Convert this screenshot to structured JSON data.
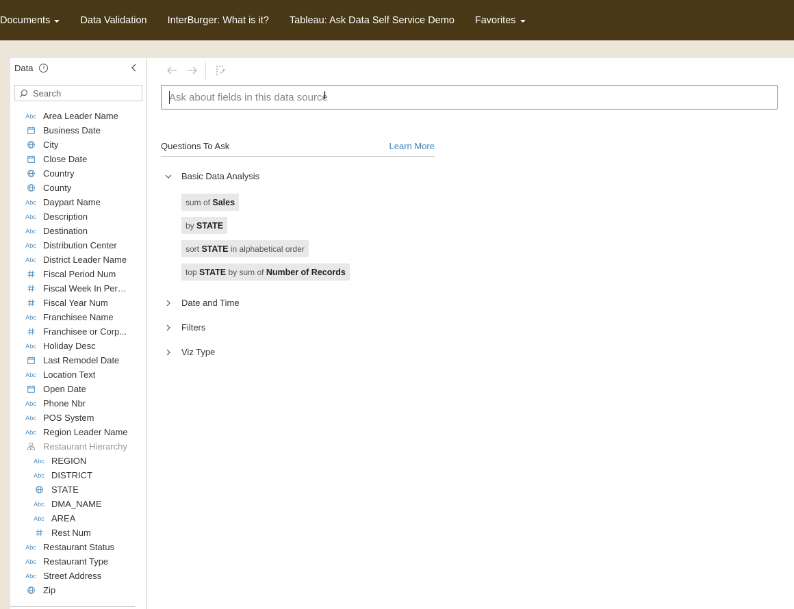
{
  "nav": {
    "items": [
      {
        "label": "Documents",
        "dropdown": true
      },
      {
        "label": "Data Validation",
        "dropdown": false
      },
      {
        "label": "InterBurger: What is it?",
        "dropdown": false
      },
      {
        "label": "Tableau: Ask Data Self Service Demo",
        "dropdown": false
      },
      {
        "label": "Favorites",
        "dropdown": true
      }
    ]
  },
  "data_pane": {
    "title": "Data",
    "search_placeholder": "Search",
    "fields": [
      {
        "label": "Area Leader Name",
        "type": "abc"
      },
      {
        "label": "Business Date",
        "type": "date"
      },
      {
        "label": "City",
        "type": "geo"
      },
      {
        "label": "Close Date",
        "type": "date"
      },
      {
        "label": "Country",
        "type": "geo"
      },
      {
        "label": "County",
        "type": "geo"
      },
      {
        "label": "Daypart Name",
        "type": "abc"
      },
      {
        "label": "Description",
        "type": "abc"
      },
      {
        "label": "Destination",
        "type": "abc"
      },
      {
        "label": "Distribution Center",
        "type": "abc"
      },
      {
        "label": "District Leader Name",
        "type": "abc"
      },
      {
        "label": "Fiscal Period Num",
        "type": "num"
      },
      {
        "label": "Fiscal Week In Perio...",
        "type": "num"
      },
      {
        "label": "Fiscal Year Num",
        "type": "num"
      },
      {
        "label": "Franchisee Name",
        "type": "abc"
      },
      {
        "label": "Franchisee or Corp...",
        "type": "num"
      },
      {
        "label": "Holiday Desc",
        "type": "abc"
      },
      {
        "label": "Last Remodel Date",
        "type": "date"
      },
      {
        "label": "Location Text",
        "type": "abc"
      },
      {
        "label": "Open Date",
        "type": "date"
      },
      {
        "label": "Phone Nbr",
        "type": "abc"
      },
      {
        "label": "POS System",
        "type": "abc"
      },
      {
        "label": "Region Leader Name",
        "type": "abc"
      },
      {
        "label": "Restaurant Hierarchy",
        "type": "hier"
      },
      {
        "label": "REGION",
        "type": "abc",
        "child": true
      },
      {
        "label": "DISTRICT",
        "type": "abc",
        "child": true
      },
      {
        "label": "STATE",
        "type": "geo",
        "child": true
      },
      {
        "label": "DMA_NAME",
        "type": "abc",
        "child": true
      },
      {
        "label": "AREA",
        "type": "abc",
        "child": true
      },
      {
        "label": "Rest Num",
        "type": "num",
        "child": true
      },
      {
        "label": "Restaurant Status",
        "type": "abc"
      },
      {
        "label": "Restaurant Type",
        "type": "abc"
      },
      {
        "label": "Street Address",
        "type": "abc"
      },
      {
        "label": "Zip",
        "type": "geo"
      }
    ]
  },
  "main": {
    "ask_placeholder": "Ask about fields in this data source",
    "questions_title": "Questions To Ask",
    "learn_more": "Learn More",
    "sections": [
      {
        "label": "Basic Data Analysis",
        "expanded": true
      },
      {
        "label": "Date and Time",
        "expanded": false
      },
      {
        "label": "Filters",
        "expanded": false
      },
      {
        "label": "Viz Type",
        "expanded": false
      }
    ],
    "suggestions": [
      [
        {
          "t": "sum of ",
          "b": false
        },
        {
          "t": "Sales",
          "b": true
        }
      ],
      [
        {
          "t": "by ",
          "b": false
        },
        {
          "t": "STATE",
          "b": true
        }
      ],
      [
        {
          "t": "sort ",
          "b": false
        },
        {
          "t": "STATE",
          "b": true
        },
        {
          "t": " in alphabetical order",
          "b": false
        }
      ],
      [
        {
          "t": "top ",
          "b": false
        },
        {
          "t": "STATE",
          "b": true
        },
        {
          "t": " by sum of ",
          "b": false
        },
        {
          "t": "Number of Records",
          "b": true
        }
      ]
    ]
  },
  "colors": {
    "nav_bg": "#483815",
    "accent": "#4d8dbf",
    "link": "#3d83b8",
    "page_bg": "#ece5da"
  }
}
